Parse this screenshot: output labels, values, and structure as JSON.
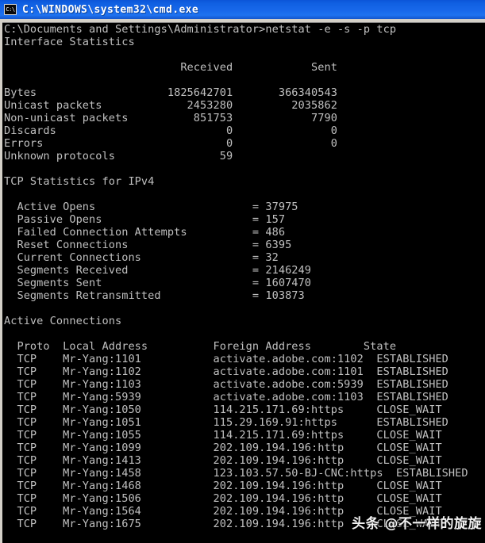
{
  "window": {
    "title": "C:\\WINDOWS\\system32\\cmd.exe",
    "icon_label": "C:\\",
    "icon_name": "cmd-console-icon",
    "titlebar_color": "#1060e2",
    "background_color": "#000000",
    "text_color": "#c0c0c0"
  },
  "console": {
    "lines": [
      "C:\\Documents and Settings\\Administrator>netstat -e -s -p tcp",
      "Interface Statistics",
      "",
      "                           Received            Sent",
      "",
      "Bytes                    1825642701       366340543",
      "Unicast packets             2453280         2035862",
      "Non-unicast packets          851753            7790",
      "Discards                          0               0",
      "Errors                            0               0",
      "Unknown protocols                59",
      "",
      "TCP Statistics for IPv4",
      "",
      "  Active Opens                        = 37975",
      "  Passive Opens                       = 157",
      "  Failed Connection Attempts          = 486",
      "  Reset Connections                   = 6395",
      "  Current Connections                 = 32",
      "  Segments Received                   = 2146249",
      "  Segments Sent                       = 1607470",
      "  Segments Retransmitted              = 103873",
      "",
      "Active Connections",
      "",
      "  Proto  Local Address          Foreign Address        State",
      "  TCP    Mr-Yang:1101           activate.adobe.com:1102  ESTABLISHED",
      "  TCP    Mr-Yang:1102           activate.adobe.com:1101  ESTABLISHED",
      "  TCP    Mr-Yang:1103           activate.adobe.com:5939  ESTABLISHED",
      "  TCP    Mr-Yang:5939           activate.adobe.com:1103  ESTABLISHED",
      "  TCP    Mr-Yang:1050           114.215.171.69:https     CLOSE_WAIT",
      "  TCP    Mr-Yang:1051           115.29.169.91:https      ESTABLISHED",
      "  TCP    Mr-Yang:1055           114.215.171.69:https     CLOSE_WAIT",
      "  TCP    Mr-Yang:1099           202.109.194.196:http     CLOSE_WAIT",
      "  TCP    Mr-Yang:1413           202.109.194.196:http     CLOSE_WAIT",
      "  TCP    Mr-Yang:1458           123.103.57.50-BJ-CNC:https  ESTABLISHED",
      "  TCP    Mr-Yang:1468           202.109.194.196:http     CLOSE_WAIT",
      "  TCP    Mr-Yang:1506           202.109.194.196:http     CLOSE_WAIT",
      "  TCP    Mr-Yang:1564           202.109.194.196:http     CLOSE_WAIT",
      "  TCP    Mr-Yang:1675           202.109.194.196:http     CLOSE_WAIT"
    ],
    "command": "netstat -e -s -p tcp",
    "prompt": "C:\\Documents and Settings\\Administrator>",
    "sections": {
      "interface_statistics": {
        "title": "Interface Statistics",
        "columns": [
          "",
          "Received",
          "Sent"
        ],
        "rows": [
          [
            "Bytes",
            "1825642701",
            "366340543"
          ],
          [
            "Unicast packets",
            "2453280",
            "2035862"
          ],
          [
            "Non-unicast packets",
            "851753",
            "7790"
          ],
          [
            "Discards",
            "0",
            "0"
          ],
          [
            "Errors",
            "0",
            "0"
          ],
          [
            "Unknown protocols",
            "59",
            ""
          ]
        ]
      },
      "tcp_statistics": {
        "title": "TCP Statistics for IPv4",
        "rows": [
          [
            "Active Opens",
            "37975"
          ],
          [
            "Passive Opens",
            "157"
          ],
          [
            "Failed Connection Attempts",
            "486"
          ],
          [
            "Reset Connections",
            "6395"
          ],
          [
            "Current Connections",
            "32"
          ],
          [
            "Segments Received",
            "2146249"
          ],
          [
            "Segments Sent",
            "1607470"
          ],
          [
            "Segments Retransmitted",
            "103873"
          ]
        ]
      },
      "active_connections": {
        "title": "Active Connections",
        "columns": [
          "Proto",
          "Local Address",
          "Foreign Address",
          "State"
        ],
        "rows": [
          [
            "TCP",
            "Mr-Yang:1101",
            "activate.adobe.com:1102",
            "ESTABLISHED"
          ],
          [
            "TCP",
            "Mr-Yang:1102",
            "activate.adobe.com:1101",
            "ESTABLISHED"
          ],
          [
            "TCP",
            "Mr-Yang:1103",
            "activate.adobe.com:5939",
            "ESTABLISHED"
          ],
          [
            "TCP",
            "Mr-Yang:5939",
            "activate.adobe.com:1103",
            "ESTABLISHED"
          ],
          [
            "TCP",
            "Mr-Yang:1050",
            "114.215.171.69:https",
            "CLOSE_WAIT"
          ],
          [
            "TCP",
            "Mr-Yang:1051",
            "115.29.169.91:https",
            "ESTABLISHED"
          ],
          [
            "TCP",
            "Mr-Yang:1055",
            "114.215.171.69:https",
            "CLOSE_WAIT"
          ],
          [
            "TCP",
            "Mr-Yang:1099",
            "202.109.194.196:http",
            "CLOSE_WAIT"
          ],
          [
            "TCP",
            "Mr-Yang:1413",
            "202.109.194.196:http",
            "CLOSE_WAIT"
          ],
          [
            "TCP",
            "Mr-Yang:1458",
            "123.103.57.50-BJ-CNC:https",
            "ESTABLISHED"
          ],
          [
            "TCP",
            "Mr-Yang:1468",
            "202.109.194.196:http",
            "CLOSE_WAIT"
          ],
          [
            "TCP",
            "Mr-Yang:1506",
            "202.109.194.196:http",
            "CLOSE_WAIT"
          ],
          [
            "TCP",
            "Mr-Yang:1564",
            "202.109.194.196:http",
            "CLOSE_WAIT"
          ],
          [
            "TCP",
            "Mr-Yang:1675",
            "202.109.194.196:http",
            "CLOSE_WAIT"
          ]
        ]
      }
    }
  },
  "watermark": {
    "text": "头条 @不一样的旋旋"
  }
}
